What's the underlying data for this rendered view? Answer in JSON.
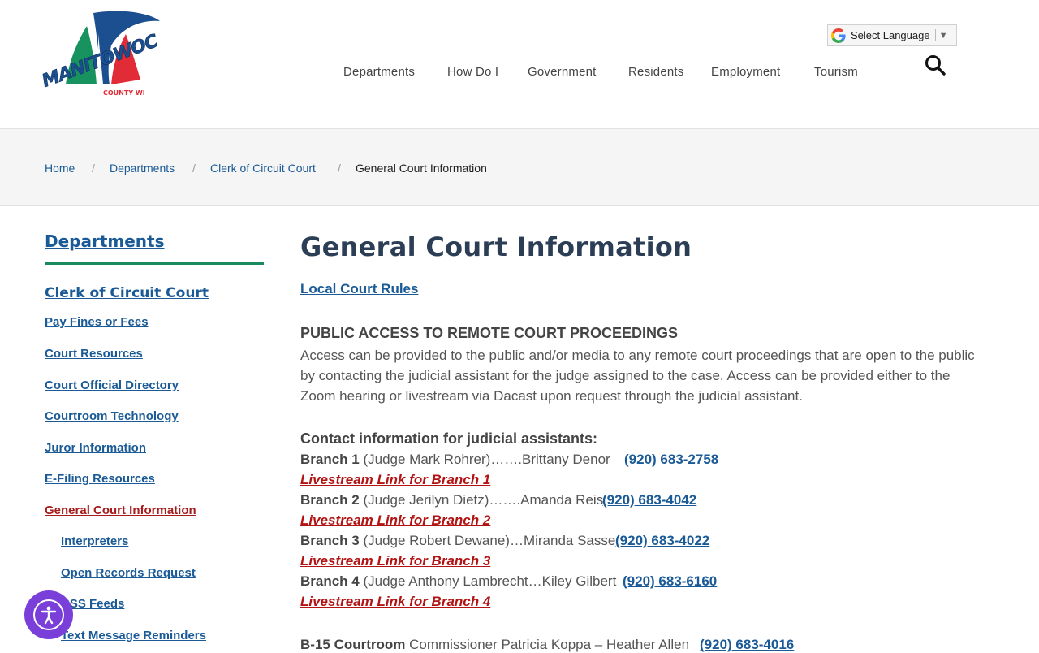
{
  "brand": {
    "name": "MANITOWOC",
    "sub": "COUNTY WI"
  },
  "language": {
    "label": "Select Language",
    "arrow": "▼"
  },
  "nav": [
    {
      "label": "Departments"
    },
    {
      "label": "How Do I"
    },
    {
      "label": "Government"
    },
    {
      "label": "Residents"
    },
    {
      "label": "Employment"
    },
    {
      "label": "Tourism"
    }
  ],
  "breadcrumb": {
    "items": [
      "Home",
      "Departments",
      "Clerk of Circuit Court"
    ],
    "current": "General Court Information",
    "separator": "/"
  },
  "sidebar": {
    "title": "Departments",
    "section": "Clerk of Circuit Court",
    "links": [
      "Pay Fines or Fees",
      "Court Resources",
      "Court Official Directory",
      "Courtroom Technology",
      "Juror Information",
      "E-Filing Resources",
      "General Court Information"
    ],
    "sublinks": [
      "Interpreters",
      "Open Records Request",
      "RSS Feeds",
      "Text Message Reminders"
    ],
    "accent_color": "#188a5e",
    "active_color": "#a51c1c"
  },
  "main": {
    "title": "General Court Information",
    "rules_link": "Local Court Rules",
    "public_access_heading": "PUBLIC ACCESS TO REMOTE COURT PROCEEDINGS",
    "public_access_lines": [
      "Access can be provided to the public and/or media to any remote court proceedings that are open to the public",
      "by contacting the judicial assistant for the judge assigned to the case.  Access can be provided either to the",
      "Zoom hearing or livestream via Dacast upon request through the judicial assistant."
    ],
    "contact_heading": "Contact information for judicial assistants:",
    "branches": [
      {
        "branch": "Branch 1",
        "detail": " (Judge Mark Rohrer)…….Brittany Denor",
        "phone": "(920) 683-2758",
        "live": "Livestream Link for Branch 1"
      },
      {
        "branch": "Branch 2",
        "detail": " (Judge Jerilyn Dietz)…….Amanda Reis",
        "phone": "(920) 683-4042",
        "live": "Livestream Link for Branch 2"
      },
      {
        "branch": "Branch 3",
        "detail": " (Judge Robert Dewane)…Miranda Sasse",
        "phone": "(920) 683-4022",
        "live": "Livestream Link for Branch 3"
      },
      {
        "branch": "Branch 4",
        "detail": " (Judge Anthony Lambrecht…Kiley Gilbert",
        "phone": "(920) 683-6160",
        "live": "Livestream Link for Branch 4"
      }
    ],
    "b15": {
      "label": "B-15 Courtroom",
      "detail": " Commissioner Patricia Koppa – Heather Allen",
      "phone": "(920) 683-4016"
    }
  },
  "icons": {
    "search": "search-icon",
    "google": "google-icon",
    "accessibility": "accessibility-icon"
  }
}
